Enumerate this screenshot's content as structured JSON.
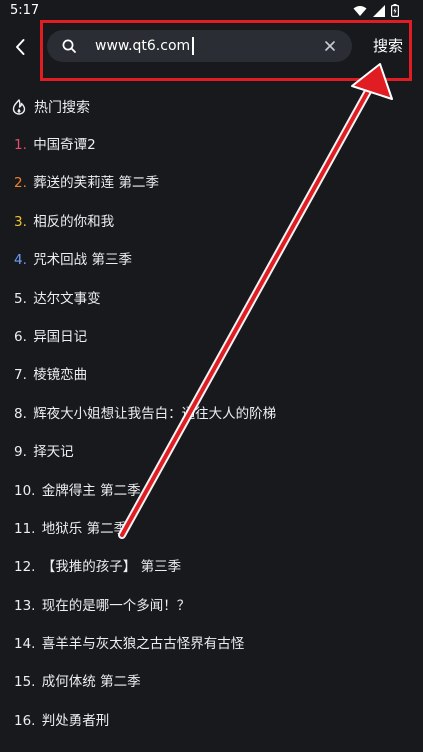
{
  "status_bar": {
    "time": "5:17"
  },
  "search": {
    "value": "www.qt6.com",
    "submit_label": "搜索"
  },
  "hot_search": {
    "title": "热门搜索",
    "items": [
      {
        "rank": "1.",
        "title": "中国奇谭2"
      },
      {
        "rank": "2.",
        "title": "葬送的芙莉莲 第二季"
      },
      {
        "rank": "3.",
        "title": "相反的你和我"
      },
      {
        "rank": "4.",
        "title": "咒术回战 第三季"
      },
      {
        "rank": "5.",
        "title": "达尔文事变"
      },
      {
        "rank": "6.",
        "title": "异国日记"
      },
      {
        "rank": "7.",
        "title": "棱镜恋曲"
      },
      {
        "rank": "8.",
        "title": "辉夜大小姐想让我告白：通往大人的阶梯"
      },
      {
        "rank": "9.",
        "title": "择天记"
      },
      {
        "rank": "10.",
        "title": "金牌得主 第二季"
      },
      {
        "rank": "11.",
        "title": "地狱乐 第二季"
      },
      {
        "rank": "12.",
        "title": "【我推的孩子】 第三季"
      },
      {
        "rank": "13.",
        "title": "现在的是哪一个多闻！？"
      },
      {
        "rank": "14.",
        "title": "喜羊羊与灰太狼之古古怪界有古怪"
      },
      {
        "rank": "15.",
        "title": "成何体统 第二季"
      },
      {
        "rank": "16.",
        "title": "判处勇者刑"
      }
    ]
  },
  "annotation": {
    "highlight_color": "#e11d24"
  },
  "icons": {
    "back": "chevron-left-icon",
    "search": "search-icon",
    "clear": "close-icon",
    "hot": "flame-icon"
  }
}
